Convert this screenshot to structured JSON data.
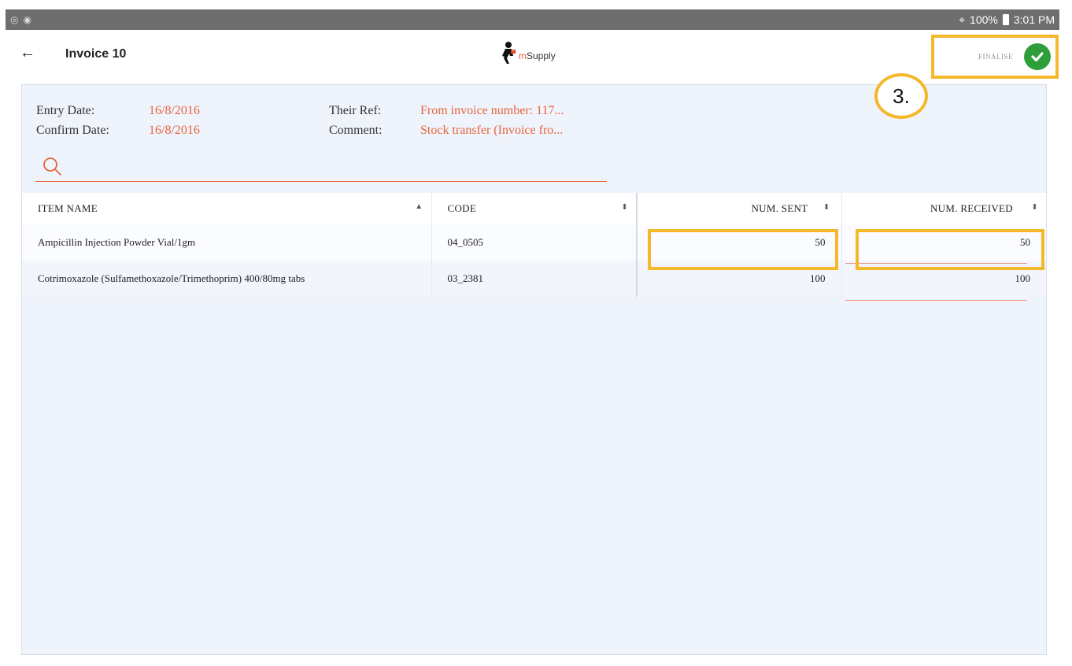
{
  "status": {
    "battery": "100%",
    "time": "3:01 PM"
  },
  "header": {
    "title": "Invoice 10",
    "logo_m": "m",
    "logo_rest": "Supply",
    "finalise_label": "FINALISE"
  },
  "annotation": {
    "step": "3."
  },
  "info": {
    "entry_date_label": "Entry Date:",
    "entry_date": "16/8/2016",
    "confirm_date_label": "Confirm Date:",
    "confirm_date": "16/8/2016",
    "their_ref_label": "Their Ref:",
    "their_ref": "From invoice number: 117...",
    "comment_label": "Comment:",
    "comment": "Stock transfer (Invoice fro..."
  },
  "table": {
    "headers": {
      "item_name": "ITEM NAME",
      "code": "CODE",
      "num_sent": "NUM. SENT",
      "num_received": "NUM. RECEIVED"
    },
    "rows": [
      {
        "item_name": "Ampicillin Injection Powder Vial/1gm",
        "code": "04_0505",
        "num_sent": "50",
        "num_received": "50"
      },
      {
        "item_name": "Cotrimoxazole (Sulfamethoxazole/Trimethoprim) 400/80mg tabs",
        "code": "03_2381",
        "num_sent": "100",
        "num_received": "100"
      }
    ]
  },
  "colors": {
    "accent": "#e8643b",
    "highlight": "#f5b82a",
    "success": "#2f9e3a"
  }
}
